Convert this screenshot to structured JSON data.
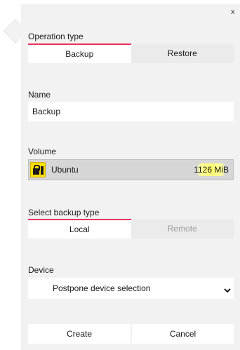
{
  "close_label": "x",
  "operation": {
    "label": "Operation type",
    "options": [
      "Backup",
      "Restore"
    ],
    "selected": "Backup"
  },
  "name": {
    "label": "Name",
    "value": "Backup"
  },
  "volume": {
    "label": "Volume",
    "name": "Ubuntu",
    "size": "1126 MiB",
    "icon": "encrypted-volume-icon"
  },
  "backup_type": {
    "label": "Select backup type",
    "options": [
      "Local",
      "Remote"
    ],
    "selected": "Local",
    "disabled": [
      "Remote"
    ]
  },
  "device": {
    "label": "Device",
    "selected": "Postpone device selection"
  },
  "actions": {
    "create": "Create",
    "cancel": "Cancel"
  },
  "colors": {
    "accent": "#e8345c",
    "volume_icon": "#ffe100",
    "panel": "#f2f2f2"
  }
}
